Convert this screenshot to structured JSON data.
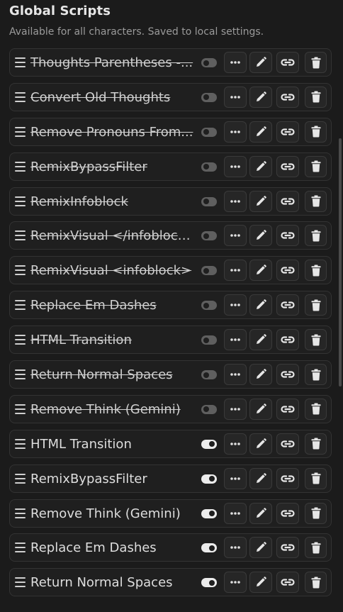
{
  "header": {
    "title": "Global Scripts",
    "subtitle": "Available for all characters. Saved to local settings."
  },
  "icons": {
    "drag": "drag-handle-icon",
    "toggle": "toggle-switch",
    "more": "ellipsis-icon",
    "edit": "pencil-icon",
    "link": "link-icon",
    "delete": "trash-icon"
  },
  "colors": {
    "background": "#1b1b1b",
    "row_background": "#1f1f1f",
    "text": "#dedede",
    "toggle_on": "#ececec",
    "toggle_off": "#5f5f5f"
  },
  "scripts": [
    {
      "name": "Thoughts Parentheses -...",
      "enabled": false
    },
    {
      "name": "Convert Old Thoughts",
      "enabled": false
    },
    {
      "name": "Remove Pronouns From...",
      "enabled": false
    },
    {
      "name": "RemixBypassFilter",
      "enabled": false
    },
    {
      "name": "RemixInfoblock",
      "enabled": false
    },
    {
      "name": "RemixVisual </infoblock>",
      "enabled": false
    },
    {
      "name": "RemixVisual <infoblock>",
      "enabled": false
    },
    {
      "name": "Replace Em Dashes",
      "enabled": false
    },
    {
      "name": "HTML Transition",
      "enabled": false
    },
    {
      "name": "Return Normal Spaces",
      "enabled": false
    },
    {
      "name": "Remove Think (Gemini)",
      "enabled": false
    },
    {
      "name": "HTML Transition",
      "enabled": true
    },
    {
      "name": "RemixBypassFilter",
      "enabled": true
    },
    {
      "name": "Remove Think (Gemini)",
      "enabled": true
    },
    {
      "name": "Replace Em Dashes",
      "enabled": true
    },
    {
      "name": "Return Normal Spaces",
      "enabled": true
    }
  ]
}
